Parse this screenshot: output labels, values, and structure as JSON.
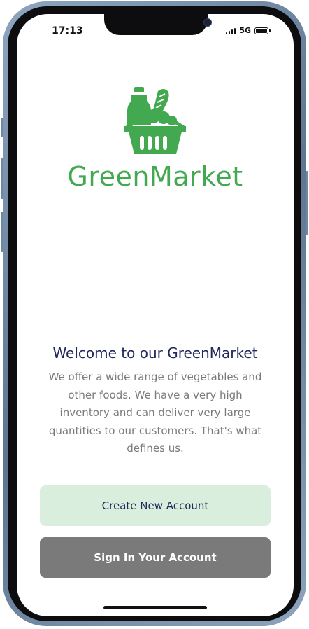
{
  "status_bar": {
    "time": "17:13",
    "network": "5G"
  },
  "brand": {
    "name": "GreenMarket",
    "color": "#43a950",
    "logo_icon": "grocery-basket-icon"
  },
  "welcome": {
    "title": "Welcome to our GreenMarket",
    "description": "We offer a wide range of vegetables and other foods. We have a very high inventory and can deliver very large quantities to our customers. That's what defines us."
  },
  "actions": {
    "create_label": "Create New Account",
    "signin_label": "Sign In Your Account"
  },
  "colors": {
    "primary_text": "#23285a",
    "secondary_text": "#7a7a7a",
    "create_bg": "#d9eedc",
    "signin_bg": "#7a7a7a"
  }
}
